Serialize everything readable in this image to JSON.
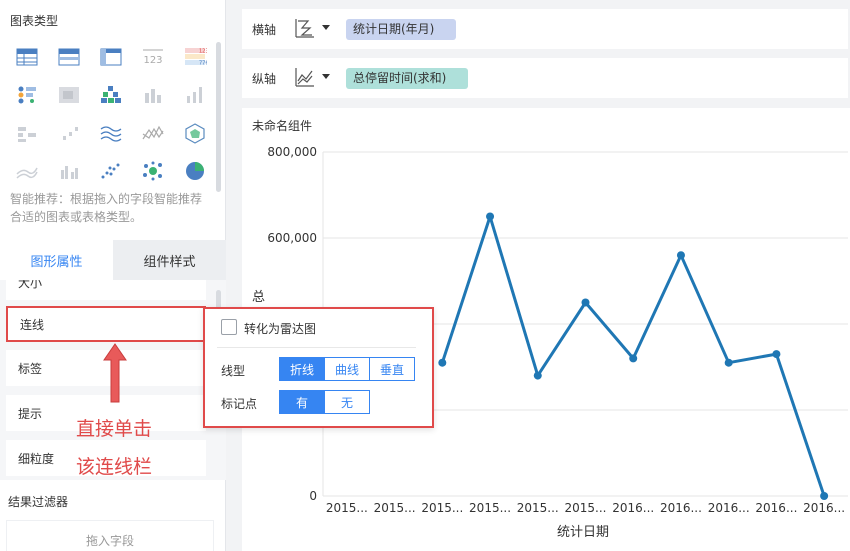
{
  "left_panel": {
    "chart_type_title": "图表类型",
    "smart_tip": "智能推荐：根据拖入的字段智能推荐合适的图表或表格类型。",
    "tabs": {
      "graphic_props": "图形属性",
      "component_style": "组件样式"
    },
    "props": {
      "cut_item": "大小",
      "line": "连线",
      "label": "标签",
      "tip": "提示",
      "granularity": "细粒度"
    },
    "filter_title": "结果过滤器",
    "drop_placeholder": "拖入字段",
    "chart_type_icons": [
      "table-icon",
      "grouped-table-icon",
      "cross-table-icon",
      "number-icon",
      "colored-number-icon",
      "dot-table-icon",
      "heat-block-icon",
      "treemap-icon",
      "bar-chart-icon",
      "column-chart-icon",
      "stacked-block-icon",
      "scatter-bars-icon",
      "multi-line-icon",
      "radar-line-icon",
      "radar-icon",
      "area-line-icon",
      "grouped-bar-icon",
      "scatter-icon",
      "bubble-icon",
      "pie-icon"
    ]
  },
  "annotation": {
    "line1": "直接单击",
    "line2": "该连线栏",
    "color": "#e04a4a"
  },
  "axes": {
    "x_label": "横轴",
    "x_field": "统计日期(年月)",
    "y_label": "纵轴",
    "y_field": "总停留时间(求和)"
  },
  "chart": {
    "widget_title": "未命名组件",
    "y_axis_partial_title": "总"
  },
  "popup": {
    "radar_label": "转化为雷达图",
    "linetype_label": "线型",
    "linetype_options": [
      "折线",
      "曲线",
      "垂直"
    ],
    "marker_label": "标记点",
    "marker_options": [
      "有",
      "无"
    ],
    "accent": "#3685f2"
  },
  "chart_data": {
    "type": "line",
    "categories": [
      "2015...",
      "2015...",
      "2015...",
      "2015...",
      "2015...",
      "2015...",
      "2016...",
      "2016...",
      "2016...",
      "2016...",
      "2016..."
    ],
    "values": [
      null,
      null,
      310000,
      650000,
      280000,
      450000,
      320000,
      560000,
      310000,
      330000,
      0
    ],
    "xlabel": "统计日期",
    "ylim": [
      0,
      800000
    ],
    "y_ticks": [
      "800,000",
      "600,000",
      "0"
    ],
    "y_tick_values": [
      800000,
      600000,
      0
    ],
    "grid": true,
    "color": "#1f77b4"
  }
}
